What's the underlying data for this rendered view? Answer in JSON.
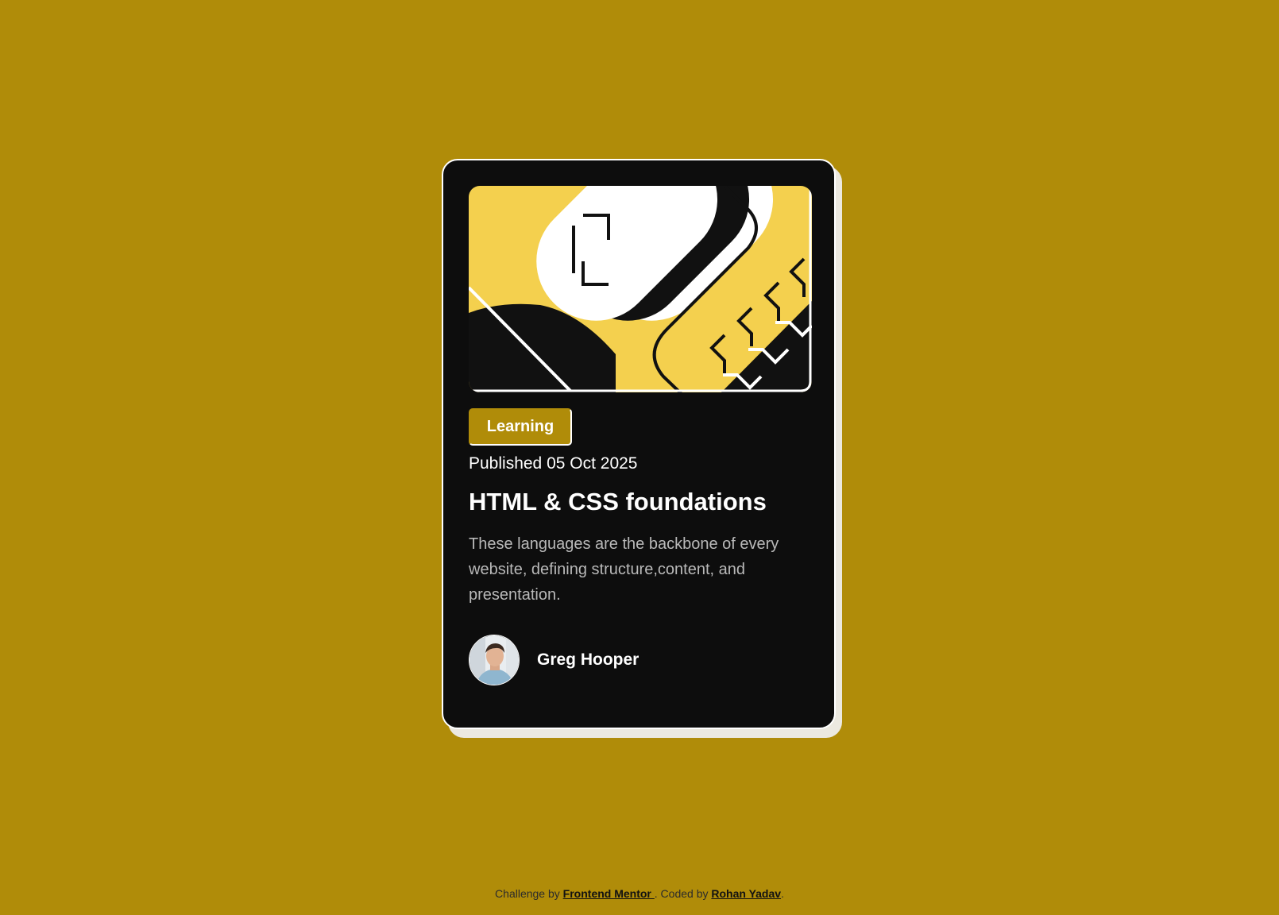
{
  "colors": {
    "background": "#b08c09",
    "card": "#0d0d0d",
    "card_shadow": "#ece9e0",
    "accent_yellow": "#f4d04e",
    "tag_background": "#b08c09",
    "tag_text": "#ffffff",
    "text_primary": "#ffffff",
    "text_secondary": "#b9b9b9"
  },
  "card": {
    "hero_image": {
      "icon": "html-css-illustration"
    },
    "tag_label": "Learning",
    "published": "Published 05 Oct 2025",
    "title": "HTML & CSS foundations",
    "description": "These languages are the backbone of every website, defining structure,content, and presentation.",
    "author": {
      "name": "Greg Hooper",
      "avatar_icon": "person-avatar"
    }
  },
  "attribution": {
    "prefix": "Challenge by ",
    "challenge_link": "Frontend Mentor ",
    "middle": ". Coded by ",
    "author_link": "Rohan Yadav",
    "suffix": "."
  }
}
